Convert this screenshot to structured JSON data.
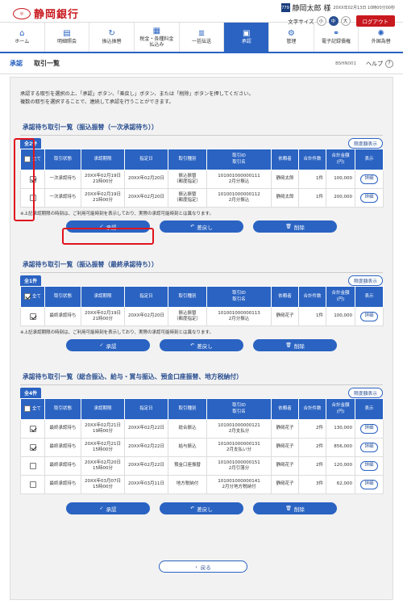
{
  "header": {
    "bank_name": "静岡銀行",
    "logo_mark": "しずぎん",
    "user_icon": "779",
    "user_name": "静岡太郎 様",
    "last_login": "20XX年02月13日 10時00分00秒",
    "font_size_label": "文字サイズ",
    "font_sizes": [
      "小",
      "中",
      "大"
    ],
    "logout_label": "ログアウト"
  },
  "nav": [
    {
      "label": "ホーム",
      "icon": "home-icon"
    },
    {
      "label": "明細照会",
      "icon": "statement-icon"
    },
    {
      "label": "振込振替",
      "icon": "transfer-icon"
    },
    {
      "label": "税金・各種料金\n払込み",
      "icon": "tax-icon"
    },
    {
      "label": "一括伝送",
      "icon": "bulk-icon"
    },
    {
      "label": "承認",
      "icon": "approve-icon",
      "active": true
    },
    {
      "label": "管理",
      "icon": "admin-icon"
    },
    {
      "label": "電子記録債権",
      "icon": "erecord-icon"
    },
    {
      "label": "外国為替",
      "icon": "forex-icon"
    }
  ],
  "breadcrumb": {
    "category": "承認",
    "page": "取引一覧",
    "screen_id": "BSHN001",
    "help": "ヘルプ"
  },
  "intro": {
    "line1": "承認する取引を選択の上、「承認」ボタン、「差戻し」ボタン、または「削除」ボタンを押してください。",
    "line2": "複数の取引を選択することで、連続して承認を行うことができます。"
  },
  "columns": {
    "all": "全て",
    "status": "取引状態",
    "deadline": "承認期限",
    "date": "指定日",
    "type": "取引種別",
    "txid_1": "取引ID",
    "txid_2": "取引名",
    "requester": "依頼者",
    "count": "合計件数",
    "amount_1": "合計金額",
    "amount_2": "(円)",
    "display": "表示"
  },
  "detail_label": "詳細",
  "expand_label": "限度額表示",
  "note": "※上記承認期限の時刻は、ご利用可能時刻を表示しており、実際の承認可能時刻とは異なります。",
  "buttons": {
    "approve": "承認",
    "return": "差戻し",
    "delete": "削除",
    "back": "戻る"
  },
  "sections": [
    {
      "title": "承認待ち取引一覧（振込振替（一次承認待ち））",
      "count": "全2件",
      "header_checked": false,
      "rows": [
        {
          "checked": true,
          "status": "一次承認待ち",
          "deadline_1": "20XX年02月19日",
          "deadline_2": "21時00分",
          "date": "20XX年02月20日",
          "type_1": "振込振替",
          "type_2": "（都度指定）",
          "txid": "101001000000111",
          "txname": "2月分振込",
          "requester": "静岡太郎",
          "count": "1件",
          "amount": "100,000"
        },
        {
          "checked": false,
          "status": "一次承認待ち",
          "deadline_1": "20XX年02月19日",
          "deadline_2": "21時00分",
          "date": "20XX年02月20日",
          "type_1": "振込振替",
          "type_2": "（都度指定）",
          "txid": "101001000000112",
          "txname": "2月分振込",
          "requester": "静岡太郎",
          "count": "1件",
          "amount": "200,000"
        }
      ]
    },
    {
      "title": "承認待ち取引一覧（振込振替（最終承認待ち））",
      "count": "全1件",
      "header_checked": true,
      "rows": [
        {
          "checked": true,
          "status": "最終承認待ち",
          "deadline_1": "20XX年02月19日",
          "deadline_2": "21時00分",
          "date": "20XX年02月20日",
          "type_1": "振込振替",
          "type_2": "（都度指定）",
          "txid": "101001000000113",
          "txname": "2月分振込",
          "requester": "静岡花子",
          "count": "1件",
          "amount": "100,000"
        }
      ]
    },
    {
      "title": "承認待ち取引一覧（総合振込、給与・賞与振込、預金口座振替、地方税納付）",
      "count": "全4件",
      "header_checked": false,
      "rows": [
        {
          "checked": true,
          "status": "最終承認待ち",
          "deadline_1": "20XX年02月21日",
          "deadline_2": "19時00分",
          "date": "20XX年02月22日",
          "type_1": "総合振込",
          "type_2": "",
          "txid": "101001000000121",
          "txname": "2月支払分",
          "requester": "静岡花子",
          "count": "2件",
          "amount": "130,000"
        },
        {
          "checked": true,
          "status": "最終承認待ち",
          "deadline_1": "20XX年02月21日",
          "deadline_2": "15時00分",
          "date": "20XX年02月22日",
          "type_1": "給与振込",
          "type_2": "",
          "txid": "101001000000131",
          "txname": "2月支払い分",
          "requester": "静岡花子",
          "count": "2件",
          "amount": "856,000"
        },
        {
          "checked": false,
          "status": "最終承認待ち",
          "deadline_1": "20XX年02月20日",
          "deadline_2": "15時00分",
          "date": "20XX年02月22日",
          "type_1": "預金口座振替",
          "type_2": "",
          "txid": "101001000000151",
          "txname": "2月引落分",
          "requester": "静岡花子",
          "count": "2件",
          "amount": "120,000"
        },
        {
          "checked": false,
          "status": "最終承認待ち",
          "deadline_1": "20XX年03月07日",
          "deadline_2": "15時00分",
          "date": "20XX年03月11日",
          "type_1": "地方税納付",
          "type_2": "",
          "txid": "101001000000141",
          "txname": "2月分地方税納付",
          "requester": "静岡花子",
          "count": "3件",
          "amount": "62,000"
        }
      ]
    }
  ],
  "colors": {
    "brand_red": "#c8191e",
    "accent_blue": "#2a63c2",
    "highlight": "#e0141e"
  }
}
